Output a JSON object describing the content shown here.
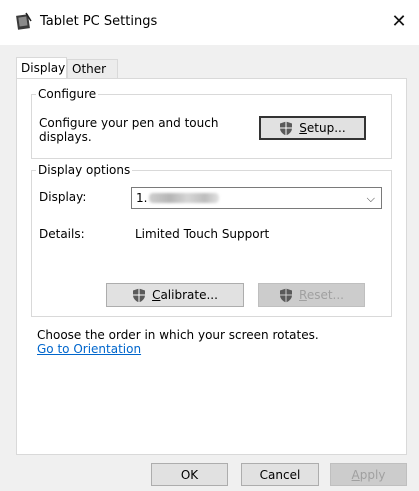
{
  "window": {
    "title": "Tablet PC Settings",
    "close_glyph": "✕"
  },
  "tabs": [
    {
      "label": "Display",
      "active": true
    },
    {
      "label": "Other",
      "active": false
    }
  ],
  "configure": {
    "legend": "Configure",
    "description": "Configure your pen and touch displays.",
    "setup_button": {
      "accel": "S",
      "rest": "etup..."
    }
  },
  "display_options": {
    "legend": "Display options",
    "display_label": "Display:",
    "display_value_prefix": "1.",
    "details_label": "Details:",
    "details_value": "Limited Touch Support",
    "calibrate_button": {
      "accel": "C",
      "rest": "alibrate..."
    },
    "reset_button": {
      "accel": "R",
      "rest": "eset...",
      "disabled": true
    }
  },
  "orientation": {
    "text": "Choose the order in which your screen rotates.",
    "link": "Go to Orientation"
  },
  "footer": {
    "ok": "OK",
    "cancel": "Cancel",
    "apply": {
      "accel": "A",
      "rest": "pply",
      "disabled": true
    }
  },
  "colors": {
    "link": "#0066cc",
    "shield_gray": "#5a5a5a"
  }
}
